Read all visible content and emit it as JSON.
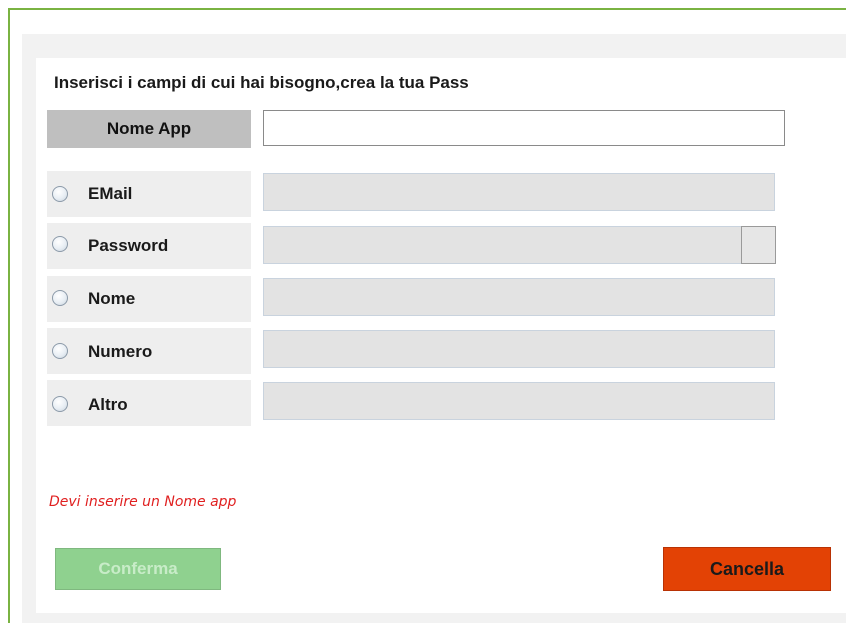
{
  "form": {
    "heading": "Inserisci i campi di cui hai bisogno,crea la tua Pass",
    "app_name_label": "Nome App",
    "app_name_value": "",
    "fields": [
      {
        "label": "EMail",
        "selected": false,
        "value": ""
      },
      {
        "label": "Password",
        "selected": false,
        "value": ""
      },
      {
        "label": "Nome",
        "selected": false,
        "value": ""
      },
      {
        "label": "Numero",
        "selected": false,
        "value": ""
      },
      {
        "label": "Altro",
        "selected": false,
        "value": ""
      }
    ],
    "error_message": "Devi inserire un Nome app",
    "confirm_label": "Conferma",
    "cancel_label": "Cancella"
  },
  "colors": {
    "frame": "#7ab342",
    "error": "#e02020",
    "confirm_disabled": "#8fd18f",
    "cancel": "#e34205"
  }
}
